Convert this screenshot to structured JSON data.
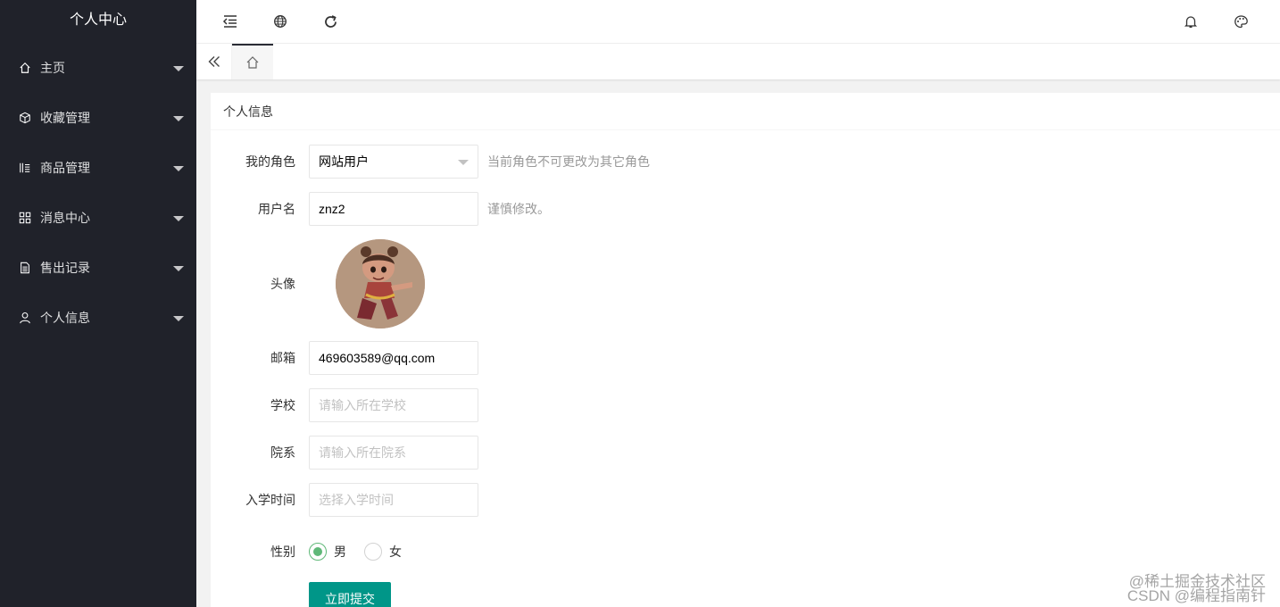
{
  "sidebar": {
    "title": "个人中心",
    "items": [
      {
        "label": "主页",
        "icon": "home-icon"
      },
      {
        "label": "收藏管理",
        "icon": "cube-icon"
      },
      {
        "label": "商品管理",
        "icon": "goods-icon"
      },
      {
        "label": "消息中心",
        "icon": "apps-icon"
      },
      {
        "label": "售出记录",
        "icon": "file-icon"
      },
      {
        "label": "个人信息",
        "icon": "user-icon"
      }
    ]
  },
  "header": {
    "icons": [
      "shrink-menu-icon",
      "globe-icon",
      "refresh-icon",
      "bell-icon",
      "palette-icon"
    ]
  },
  "tabs": {
    "prev_icon": "double-chevron-left-icon",
    "home_icon": "home-icon"
  },
  "card": {
    "title": "个人信息"
  },
  "form": {
    "role": {
      "label": "我的角色",
      "value": "网站用户",
      "aux": "当前角色不可更改为其它角色"
    },
    "username": {
      "label": "用户名",
      "value": "znz2",
      "aux": "谨慎修改。"
    },
    "avatar": {
      "label": "头像"
    },
    "email": {
      "label": "邮箱",
      "value": "469603589@qq.com"
    },
    "school": {
      "label": "学校",
      "value": "",
      "placeholder": "请输入所在学校"
    },
    "department": {
      "label": "院系",
      "value": "",
      "placeholder": "请输入所在院系"
    },
    "enroll_date": {
      "label": "入学时间",
      "value": "",
      "placeholder": "选择入学时间"
    },
    "gender": {
      "label": "性别",
      "options": [
        "男",
        "女"
      ],
      "selected": "男"
    },
    "submit_label": "立即提交"
  },
  "watermark": {
    "line1": "@稀土掘金技术社区",
    "line2": "CSDN @编程指南针"
  },
  "colors": {
    "sidebar_bg": "#20222a",
    "primary_button": "#009688",
    "radio_checked": "#5fb878"
  }
}
